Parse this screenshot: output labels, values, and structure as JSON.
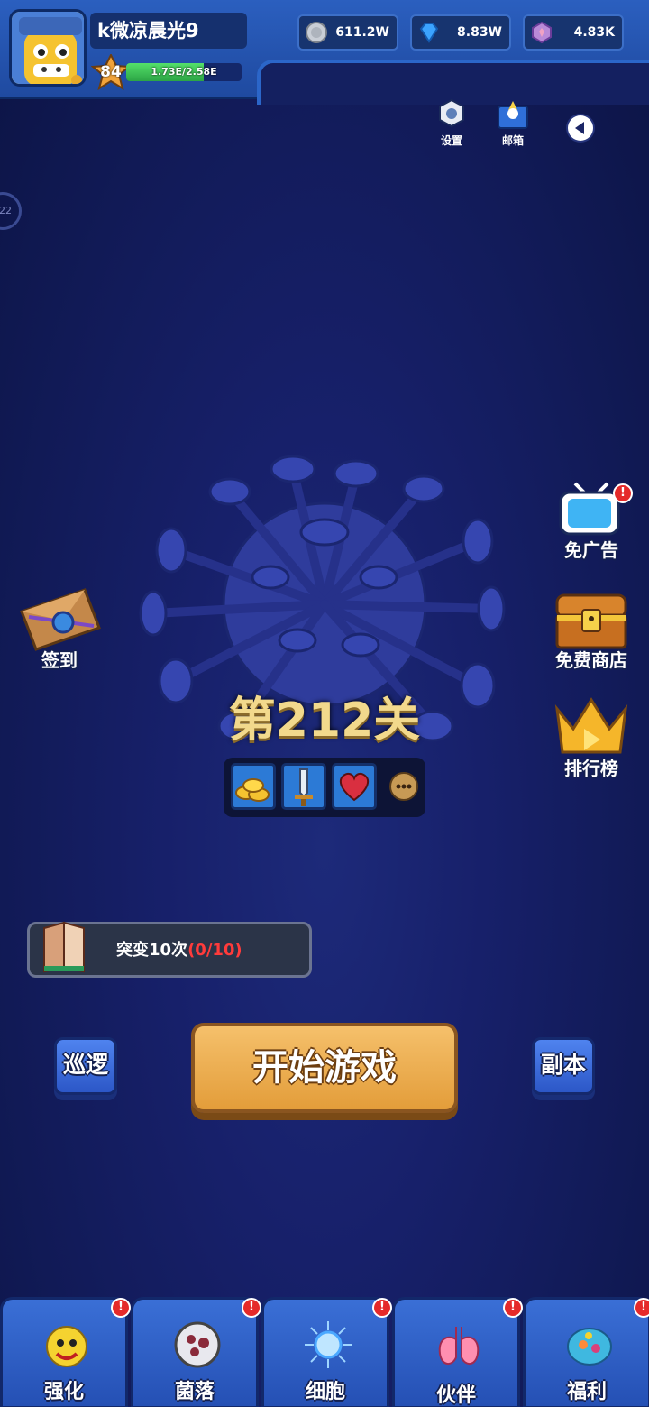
{
  "player": {
    "name": "k微凉晨光9",
    "level": "84",
    "exp_text": "1.73E/2.58E",
    "exp_fraction": 0.67
  },
  "currencies": [
    {
      "icon": "silver-coin-icon",
      "value": "611.2W"
    },
    {
      "icon": "blue-diamond-icon",
      "value": "8.83W"
    },
    {
      "icon": "purple-gem-icon",
      "value": "4.83K"
    }
  ],
  "top_actions": {
    "settings_label": "设置",
    "mail_label": "邮箱"
  },
  "side_left": {
    "counter_text": "22",
    "signin_label": "签到"
  },
  "side_right": {
    "free_ad_label": "免广告",
    "free_shop_label": "免费商店",
    "ranking_label": "排行榜",
    "badge": "!"
  },
  "stage": {
    "title": "第212关",
    "rewards": [
      "gold-coins-icon",
      "sword-icon",
      "heart-icon"
    ]
  },
  "quest": {
    "text": "突变10次",
    "progress": "(0/10)"
  },
  "buttons": {
    "patrol": "巡逻",
    "start": "开始游戏",
    "dungeon": "副本"
  },
  "nav": [
    {
      "label": "强化",
      "icon": "upgrade-icon",
      "badge": "!"
    },
    {
      "label": "菌落",
      "icon": "colony-icon",
      "badge": "!"
    },
    {
      "label": "细胞",
      "icon": "cell-icon",
      "badge": "!"
    },
    {
      "label": "伙伴",
      "icon": "partner-icon",
      "badge": "!"
    },
    {
      "label": "福利",
      "icon": "welfare-icon",
      "badge": "!"
    }
  ],
  "colors": {
    "background": "#17206a",
    "start_button": "#e39d3a",
    "quest_progress": "#ff3b3b",
    "stage_title": "#f2d98c"
  }
}
